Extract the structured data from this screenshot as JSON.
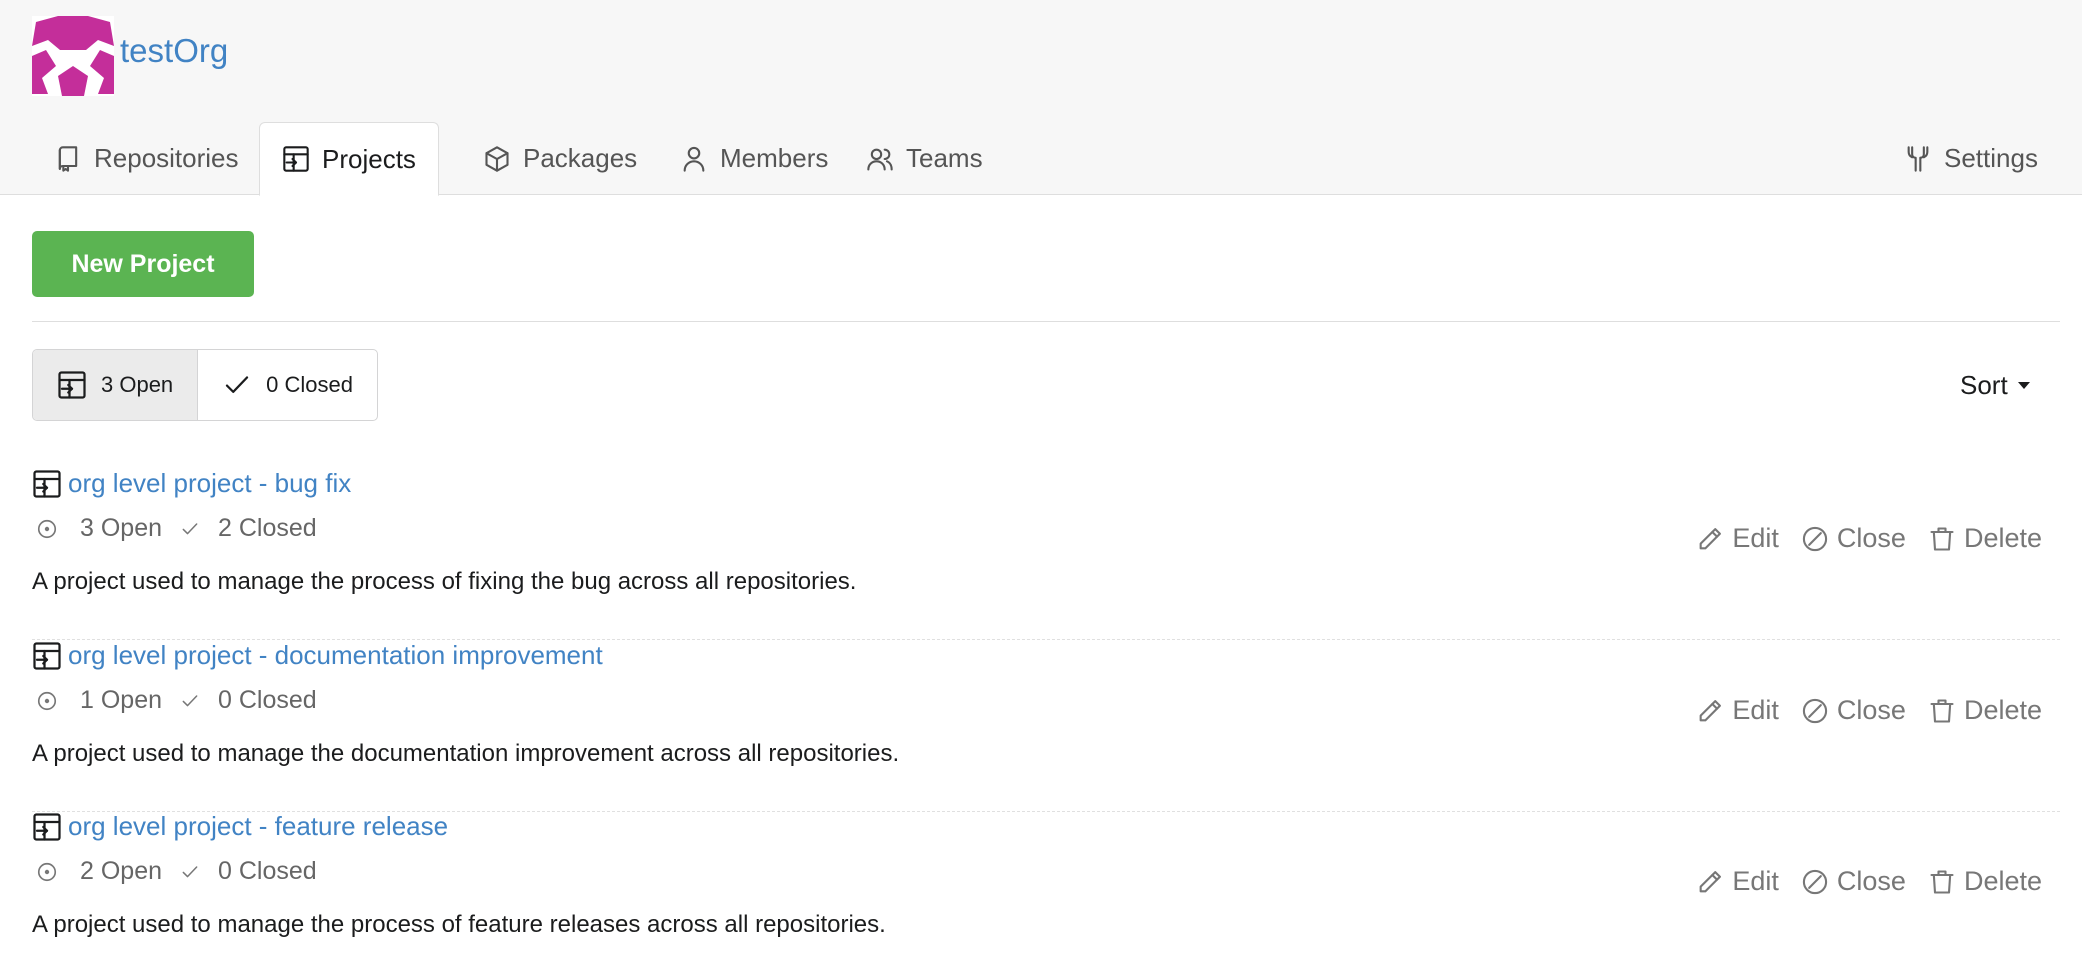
{
  "org": {
    "name": "testOrg",
    "logo_color": "#c42e9a"
  },
  "tabs": [
    {
      "label": "Repositories",
      "icon": "repo-icon"
    },
    {
      "label": "Projects",
      "icon": "project-icon",
      "active": true
    },
    {
      "label": "Packages",
      "icon": "package-icon"
    },
    {
      "label": "Members",
      "icon": "person-icon"
    },
    {
      "label": "Teams",
      "icon": "people-icon"
    }
  ],
  "settings_label": "Settings",
  "new_project_label": "New Project",
  "filters": {
    "open_label": "3 Open",
    "closed_label": "0 Closed"
  },
  "sort_label": "Sort",
  "actions": {
    "edit": "Edit",
    "close": "Close",
    "delete": "Delete"
  },
  "projects": [
    {
      "title": "org level project - bug fix",
      "open": "3 Open",
      "closed": "2 Closed",
      "description": "A project used to manage the process of fixing the bug across all repositories."
    },
    {
      "title": "org level project - documentation improvement",
      "open": "1 Open",
      "closed": "0 Closed",
      "description": "A project used to manage the documentation improvement across all repositories."
    },
    {
      "title": "org level project - feature release",
      "open": "2 Open",
      "closed": "0 Closed",
      "description": "A project used to manage the process of feature releases across all repositories."
    }
  ],
  "colors": {
    "link": "#4183c4",
    "primary_button": "#5bb452",
    "header_bg": "#f7f7f7"
  }
}
